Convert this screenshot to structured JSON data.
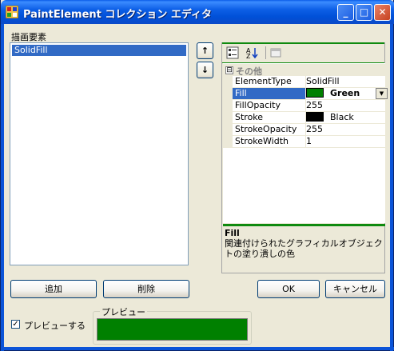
{
  "window": {
    "title": "PaintElement コレクション エディタ",
    "controls": {
      "minimize": "_",
      "maximize": "□",
      "close": "✕"
    }
  },
  "members": {
    "label": "描画要素",
    "items": [
      {
        "label": "SolidFill",
        "selected": true
      }
    ],
    "up_arrow": "↑",
    "down_arrow": "↓"
  },
  "propertyGrid": {
    "toolbar": {
      "categorized_icon": "categorized-icon",
      "alphabetical_icon": "alphabetical-icon",
      "pages_icon": "property-pages-icon"
    },
    "category": {
      "toggle": "⊟",
      "name": "その他"
    },
    "rows": [
      {
        "name": "ElementType",
        "value": "SolidFill"
      },
      {
        "name": "Fill",
        "value": "Green",
        "swatch": "#008000",
        "selected": true
      },
      {
        "name": "FillOpacity",
        "value": "255"
      },
      {
        "name": "Stroke",
        "value": "Black",
        "swatch": "#000000"
      },
      {
        "name": "StrokeOpacity",
        "value": "255"
      },
      {
        "name": "StrokeWidth",
        "value": "1"
      }
    ],
    "description": {
      "title": "Fill",
      "text": "関連付けられたグラフィカルオブジェクトの塗り潰しの色"
    }
  },
  "buttons": {
    "add": "追加",
    "remove": "削除",
    "ok": "OK",
    "cancel": "キャンセル"
  },
  "preview": {
    "checkbox_label": "プレビューする",
    "checked": true,
    "group_title": "プレビュー",
    "color": "#008000"
  },
  "colors": {
    "titlebar": "#0054e3",
    "selection": "#316ac5",
    "accent_line": "#0f8a0f"
  }
}
